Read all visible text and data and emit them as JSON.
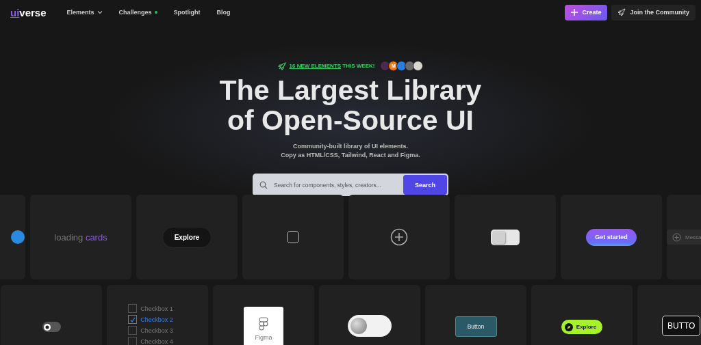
{
  "header": {
    "logo": {
      "accent": "ui",
      "rest": "verse"
    },
    "nav": [
      {
        "label": "Elements",
        "kind": "dropdown"
      },
      {
        "label": "Challenges",
        "kind": "dot"
      },
      {
        "label": "Spotlight",
        "kind": "plain"
      },
      {
        "label": "Blog",
        "kind": "plain"
      }
    ],
    "create_button": "Create",
    "community_button": "Join the Community"
  },
  "hero": {
    "announcement": {
      "link": "16 NEW ELEMENTS",
      "text": "THIS WEEK!"
    },
    "avatars": [
      {
        "color": "#4a2a4e"
      },
      {
        "color": "#f07a10",
        "initial": "M"
      },
      {
        "color": "#2a7de1"
      },
      {
        "color": "#6b6b6b"
      },
      {
        "color": "#d8d8d0"
      }
    ],
    "title": [
      "The Largest Library",
      "of Open-Source UI"
    ],
    "subtitle": [
      "Community-built library of UI elements.",
      "Copy as HTML/CSS, Tailwind, React and Figma."
    ],
    "search": {
      "placeholder": "Search for components, styles, creators...",
      "button": "Search"
    }
  },
  "rows": [
    [
      {
        "kind": "blue-dot"
      },
      {
        "kind": "loading",
        "text": "loading",
        "accent": "cards"
      },
      {
        "kind": "pill",
        "label": "Explore"
      },
      {
        "kind": "square",
        "checked": false
      },
      {
        "kind": "plus"
      },
      {
        "kind": "toggle3d",
        "on": false
      },
      {
        "kind": "gradient",
        "label": "Get started"
      },
      {
        "kind": "message",
        "placeholder": "Messa"
      }
    ],
    [
      {
        "kind": "switch",
        "on": false
      },
      {
        "kind": "checkboxes",
        "items": [
          {
            "label": "Checkbox 1",
            "checked": false
          },
          {
            "label": "Checkbox 2",
            "checked": true
          },
          {
            "label": "Checkbox 3",
            "checked": false
          },
          {
            "label": "Checkbox 4",
            "checked": false
          }
        ]
      },
      {
        "kind": "figma",
        "label": "Figma"
      },
      {
        "kind": "neutoggle",
        "on": false
      },
      {
        "kind": "glass",
        "label": "Button"
      },
      {
        "kind": "lime",
        "label": "Explore"
      },
      {
        "kind": "outline",
        "label": "BUTTO"
      }
    ]
  ]
}
